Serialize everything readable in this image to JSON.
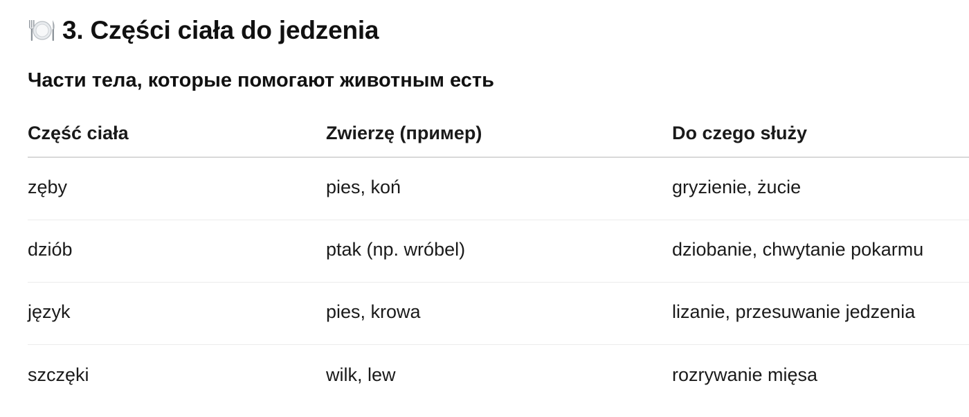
{
  "section": {
    "icon": "fork-knife-plate-icon",
    "title": "3. Części ciała do jedzenia",
    "subtitle": "Части тела, которые помогают животным есть"
  },
  "table": {
    "columns": [
      "Część ciała",
      "Zwierzę (пример)",
      "Do czego służy"
    ],
    "rows": [
      [
        "zęby",
        "pies, koń",
        "gryzienie, żucie"
      ],
      [
        "dziób",
        "ptak (np. wróbel)",
        "dziobanie, chwytanie pokarmu"
      ],
      [
        "język",
        "pies, krowa",
        "lizanie, przesuwanie jedzenia"
      ],
      [
        "szczęki",
        "wilk, lew",
        "rozrywanie mięsa"
      ]
    ]
  }
}
